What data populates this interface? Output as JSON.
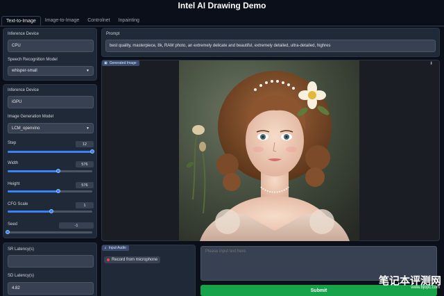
{
  "app": {
    "title": "Intel AI Drawing Demo"
  },
  "tabs": [
    "Text-to-Image",
    "Image-to-Image",
    "Controlnet",
    "Inpainting"
  ],
  "speech_panel": {
    "device_label": "Inference Device",
    "device_value": "CPU",
    "model_label": "Speech Recognition Model",
    "model_value": "whisper-small"
  },
  "image_panel": {
    "device_label": "Inference Device",
    "device_value": "iGPU",
    "model_label": "Image Generation Model",
    "model_value": "LCM_openvino",
    "sliders": [
      {
        "label": "Step",
        "value": "12",
        "fraction": 1.0
      },
      {
        "label": "Width",
        "value": "576",
        "fraction": 0.6
      },
      {
        "label": "Height",
        "value": "576",
        "fraction": 0.6
      },
      {
        "label": "CFG Scale",
        "value": "1",
        "fraction": 0.52
      },
      {
        "label": "Seed",
        "value": "-1",
        "fraction": 0.0
      }
    ]
  },
  "latency_panel": {
    "sr_label": "SR Latency(s)",
    "sr_value": "",
    "sd_label": "SD Latency(s)",
    "sd_value": "4.82"
  },
  "prompt": {
    "label": "Prompt",
    "value": "best quality, masterpiece, 8k, RAW photo, an extremely delicate and beautiful, extremely detailed, ultra-detailed, highres"
  },
  "output": {
    "label": "Generated Image"
  },
  "audio": {
    "label": "Input Audio",
    "record_label": "Record from microphone"
  },
  "text_input": {
    "placeholder": "Please input text here."
  },
  "submit": {
    "label": "Submit"
  },
  "watermark": {
    "line1": "笔记本评测网",
    "line2": "www.bjbpc.com"
  },
  "colors": {
    "accent": "#3b82f6",
    "submit": "#16a34a",
    "background": "#0b0f19",
    "panel": "#1f2937"
  }
}
